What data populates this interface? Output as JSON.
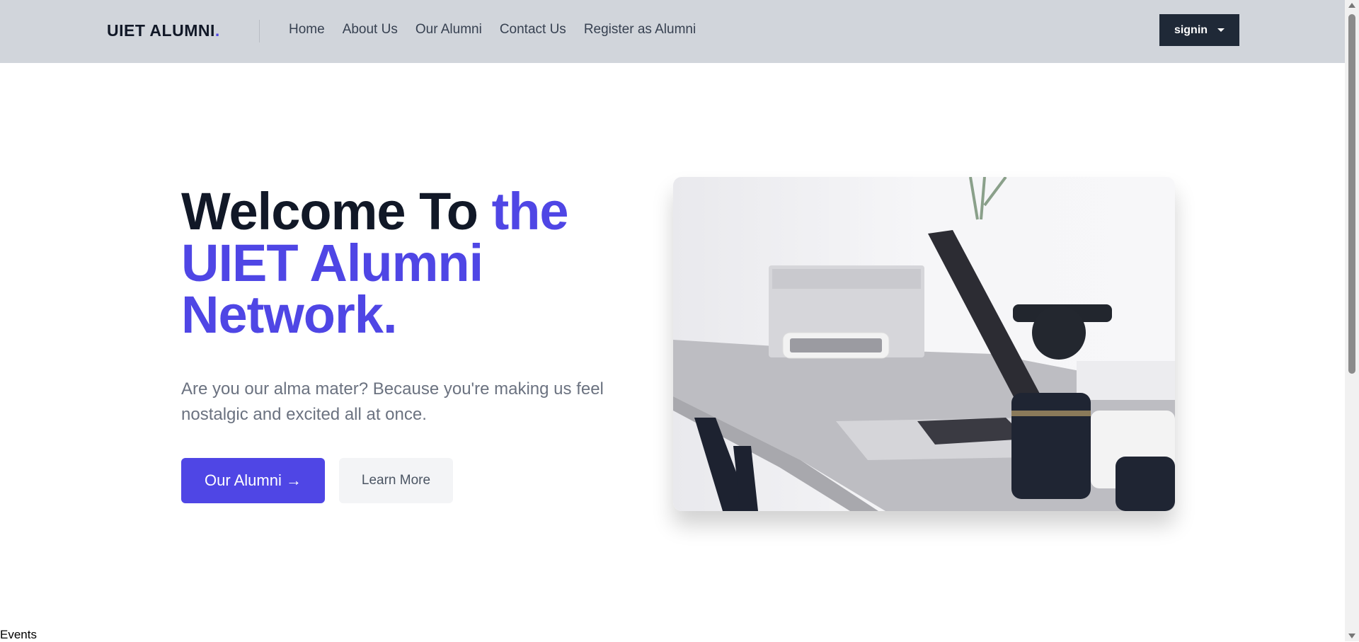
{
  "navbar": {
    "logo": "UIET ALUMNI",
    "logo_dot": ".",
    "links": [
      "Home",
      "About Us",
      "Our Alumni",
      "Contact Us",
      "Register as Alumni"
    ],
    "signin_label": "signin"
  },
  "hero": {
    "title_part1": "Welcome To ",
    "title_part2": "the UIET Alumni Network.",
    "subtitle": "Are you our alma mater? Because you're making us feel nostalgic and excited all at once.",
    "primary_button": "Our Alumni →",
    "secondary_button": "Learn More"
  },
  "footer_label": "Events",
  "colors": {
    "accent": "#4f46e5",
    "navbar": "#d1d5db",
    "dark": "#111827",
    "signin": "#1f2937"
  }
}
